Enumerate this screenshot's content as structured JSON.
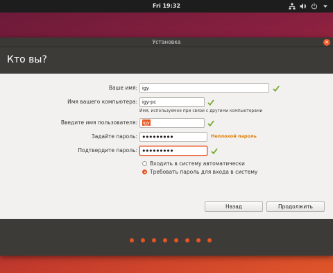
{
  "panel": {
    "clock": "Fri 19:32"
  },
  "window": {
    "title": "Установка",
    "heading": "Кто вы?"
  },
  "form": {
    "name": {
      "label": "Ваше имя:",
      "value": "igy"
    },
    "computer": {
      "label": "Имя вашего компьютера:",
      "value": "igy-pc",
      "hint": "Имя, используемое при связи с другими компьютерами"
    },
    "username": {
      "label": "Введите имя пользователя:",
      "value": "igy"
    },
    "password": {
      "label": "Задайте пароль:",
      "value": "●●●●●●●●●",
      "strength": "Неплохой пароль"
    },
    "confirm": {
      "label": "Подтвердите пароль:",
      "value": "●●●●●●●●●"
    },
    "login_options": [
      {
        "label": "Входить в систему автоматически",
        "selected": false
      },
      {
        "label": "Требовать пароль для входа в систему",
        "selected": true
      }
    ]
  },
  "buttons": {
    "back": "Назад",
    "continue": "Продолжить"
  },
  "progress": {
    "total_steps": 8
  },
  "colors": {
    "accent": "#e95420",
    "check": "#73a92a",
    "dark": "#3c3b37",
    "warning": "#e07b00"
  },
  "icons": [
    "network-icon",
    "volume-icon",
    "power-icon",
    "menu-arrow-icon",
    "close-icon",
    "check-icon"
  ]
}
